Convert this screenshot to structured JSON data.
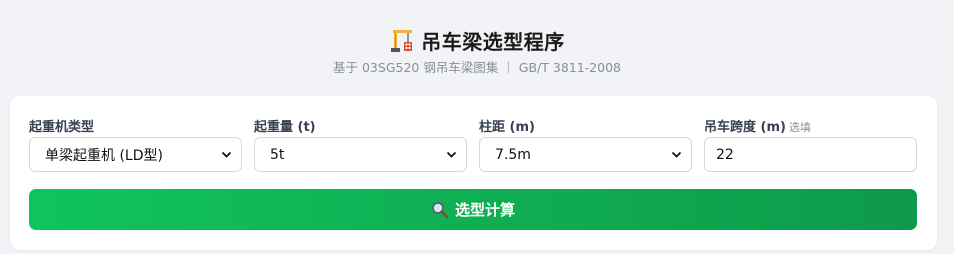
{
  "header": {
    "title": "吊车梁选型程序",
    "subtitle": "基于 03SG520 钢吊车梁图集 ｜ GB/T 3811-2008",
    "icon": "construction-crane-icon"
  },
  "form": {
    "crane_type": {
      "label": "起重机类型",
      "value": "单梁起重机 (LD型)"
    },
    "capacity": {
      "label": "起重量 (t)",
      "value": "5t"
    },
    "column_spacing": {
      "label": "柱距 (m)",
      "value": "7.5m"
    },
    "span": {
      "label": "吊车跨度 (m)",
      "hint": "选填",
      "value": "22"
    }
  },
  "submit": {
    "label": "选型计算",
    "icon": "magnifier-icon"
  },
  "colors": {
    "accent_start": "#10c45c",
    "accent_end": "#0e9a4a"
  }
}
